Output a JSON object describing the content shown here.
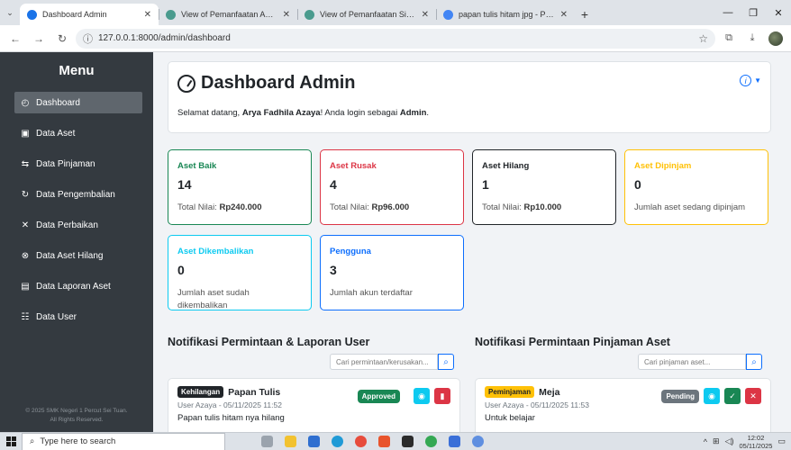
{
  "browser": {
    "tabs": [
      {
        "title": "Dashboard Admin",
        "favicon_color": "#1a73e8",
        "active": true
      },
      {
        "title": "View of Pemanfaatan Aplikasi M",
        "favicon_color": "#4a9b8e",
        "active": false
      },
      {
        "title": "View of Pemanfaatan Sistem Inf",
        "favicon_color": "#4a9b8e",
        "active": false
      },
      {
        "title": "papan tulis hitam jpg - Penelusu",
        "favicon_color": "#4285f4",
        "active": false
      }
    ],
    "url": "127.0.0.1:8000/admin/dashboard"
  },
  "sidebar": {
    "title": "Menu",
    "items": [
      {
        "label": "Dashboard",
        "icon": "gauge-icon",
        "glyph": "◴",
        "active": true
      },
      {
        "label": "Data Aset",
        "icon": "box-icon",
        "glyph": "▣"
      },
      {
        "label": "Data Pinjaman",
        "icon": "swap-icon",
        "glyph": "⇆"
      },
      {
        "label": "Data Pengembalian",
        "icon": "return-arrows-icon",
        "glyph": "↻"
      },
      {
        "label": "Data Perbaikan",
        "icon": "tools-icon",
        "glyph": "✕"
      },
      {
        "label": "Data Aset Hilang",
        "icon": "x-circle-icon",
        "glyph": "⊗"
      },
      {
        "label": "Data Laporan Aset",
        "icon": "file-report-icon",
        "glyph": "▤"
      },
      {
        "label": "Data User",
        "icon": "people-icon",
        "glyph": "☷"
      }
    ],
    "footer_line1": "© 2025 SMK Negeri 1 Percut Sei Tuan.",
    "footer_line2": "All Rights Reserved."
  },
  "header": {
    "title": "Dashboard Admin",
    "welcome_prefix": "Selamat datang, ",
    "user_name": "Arya Fadhila Azaya",
    "welcome_middle": "! Anda login sebagai ",
    "role": "Admin",
    "welcome_suffix": "."
  },
  "stats": [
    {
      "label": "Aset Baik",
      "value": "14",
      "desc_prefix": "Total Nilai: ",
      "desc_bold": "Rp240.000",
      "color": "#198754"
    },
    {
      "label": "Aset Rusak",
      "value": "4",
      "desc_prefix": "Total Nilai: ",
      "desc_bold": "Rp96.000",
      "color": "#dc3545"
    },
    {
      "label": "Aset Hilang",
      "value": "1",
      "desc_prefix": "Total Nilai: ",
      "desc_bold": "Rp10.000",
      "color": "#212529"
    },
    {
      "label": "Aset Dipinjam",
      "value": "0",
      "desc_prefix": "Jumlah aset sedang dipinjam",
      "desc_bold": "",
      "color": "#ffc107"
    },
    {
      "label": "Aset Dikembalikan",
      "value": "0",
      "desc_prefix": "Jumlah aset sudah dikembalikan",
      "desc_bold": "",
      "color": "#0dcaf0"
    },
    {
      "label": "Pengguna",
      "value": "3",
      "desc_prefix": "Jumlah akun terdaftar",
      "desc_bold": "",
      "color": "#0d6efd"
    }
  ],
  "notif_user": {
    "title": "Notifikasi Permintaan & Laporan User",
    "search_placeholder": "Cari permintaan/kerusakan...",
    "item": {
      "badge": "Kehilangan",
      "name": "Papan Tulis",
      "meta": "User Azaya - 05/11/2025 11:52",
      "body": "Papan tulis hitam nya hilang",
      "status": "Approved"
    }
  },
  "notif_loan": {
    "title": "Notifikasi Permintaan Pinjaman Aset",
    "search_placeholder": "Cari pinjaman aset...",
    "item": {
      "badge": "Peminjaman",
      "name": "Meja",
      "meta": "User Azaya - 05/11/2025 11:53",
      "body": "Untuk belajar",
      "status": "Pending"
    }
  },
  "taskbar": {
    "search_placeholder": "Type here to search",
    "time": "12:02",
    "date": "05/11/2025"
  }
}
